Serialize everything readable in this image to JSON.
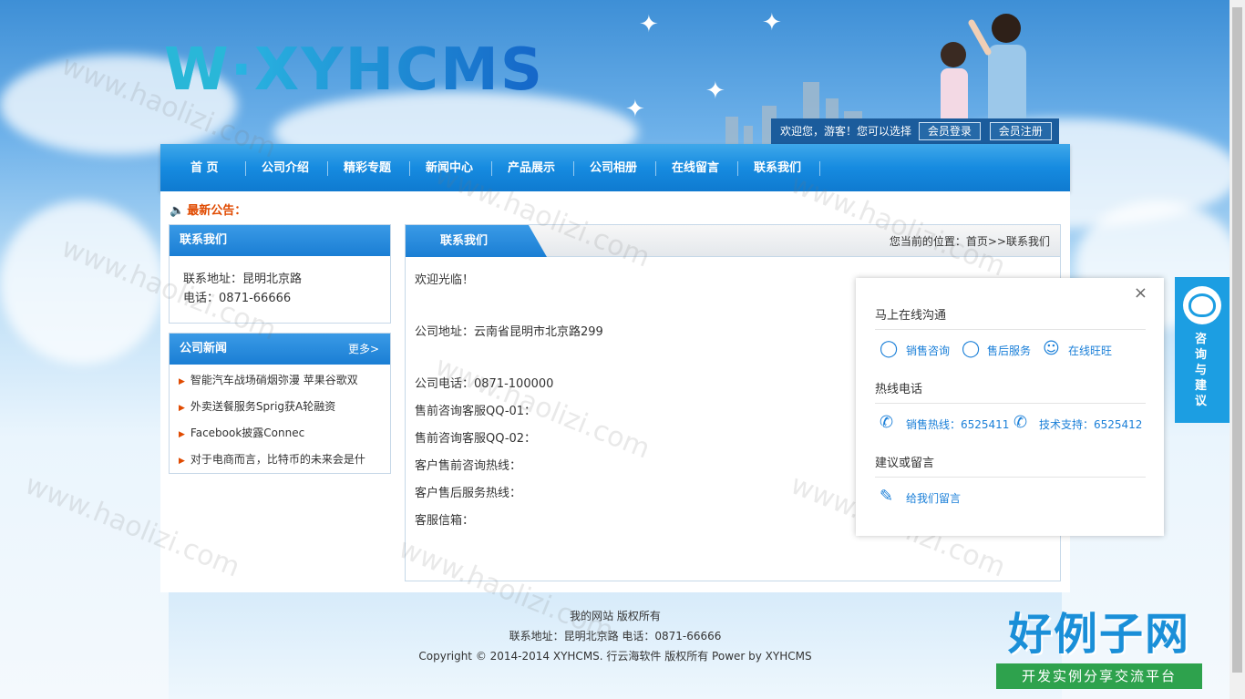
{
  "header": {
    "logo_text": "XYHCMS",
    "logo_mark": "W",
    "member_bar": {
      "welcome": "欢迎您，游客！您可以选择",
      "login_label": "会员登录",
      "register_label": "会员注册"
    }
  },
  "nav": {
    "items": [
      "首 页",
      "公司介绍",
      "精彩专题",
      "新闻中心",
      "产品展示",
      "公司相册",
      "在线留言",
      "联系我们"
    ]
  },
  "notice": {
    "label": "最新公告："
  },
  "sidebar": {
    "contact": {
      "title": "联系我们",
      "address": "联系地址：昆明北京路",
      "phone": "电话：0871-66666"
    },
    "news": {
      "title": "公司新闻",
      "more_label": "更多>",
      "items": [
        "智能汽车战场硝烟弥漫 苹果谷歌双",
        "外卖送餐服务Sprig获A轮融资",
        "Facebook披露Connec",
        "对于电商而言，比特币的未来会是什"
      ]
    }
  },
  "content": {
    "tab_title": "联系我们",
    "breadcrumb": "您当前的位置：首页>>联系我们",
    "lines": [
      "欢迎光临！",
      "公司地址：云南省昆明市北京路299",
      "公司电话：0871-100000",
      "售前咨询客服QQ-01：",
      "售前咨询客服QQ-02：",
      "客户售前咨询热线：",
      "客户售后服务热线：",
      "客服信箱："
    ]
  },
  "footer": {
    "line1": "我的网站 版权所有",
    "line2": "联系地址：昆明北京路 电话：0871-66666",
    "line3": "Copyright © 2014-2014 XYHCMS. 行云海软件 版权所有   Power by XYHCMS"
  },
  "chat_panel": {
    "close": "×",
    "section1": "马上在线沟通",
    "sales_consult": "销售咨询",
    "after_sales": "售后服务",
    "wangwang": "在线旺旺",
    "section2": "热线电话",
    "sales_hotline": "销售热线：6525411",
    "tech_support": "技术支持：6525412",
    "section3": "建议或留言",
    "leave_message": "给我们留言"
  },
  "side_tab": {
    "label": "咨询与建议"
  },
  "watermark": {
    "text": "www.haolizi.com"
  },
  "brand": {
    "title": "好例子网",
    "subtitle": "开发实例分享交流平台"
  },
  "colors": {
    "primary_blue": "#1a7ed4",
    "notice_orange": "#e04a00",
    "link_blue": "#1a7fd8",
    "brand_green": "#2ea24d"
  },
  "icons": {
    "notice": "speaker-icon",
    "qq": "qq-icon",
    "wangwang": "wangwang-icon",
    "phone": "phone-icon",
    "message": "edit-icon",
    "close": "close-icon",
    "support": "customer-service-icon"
  }
}
